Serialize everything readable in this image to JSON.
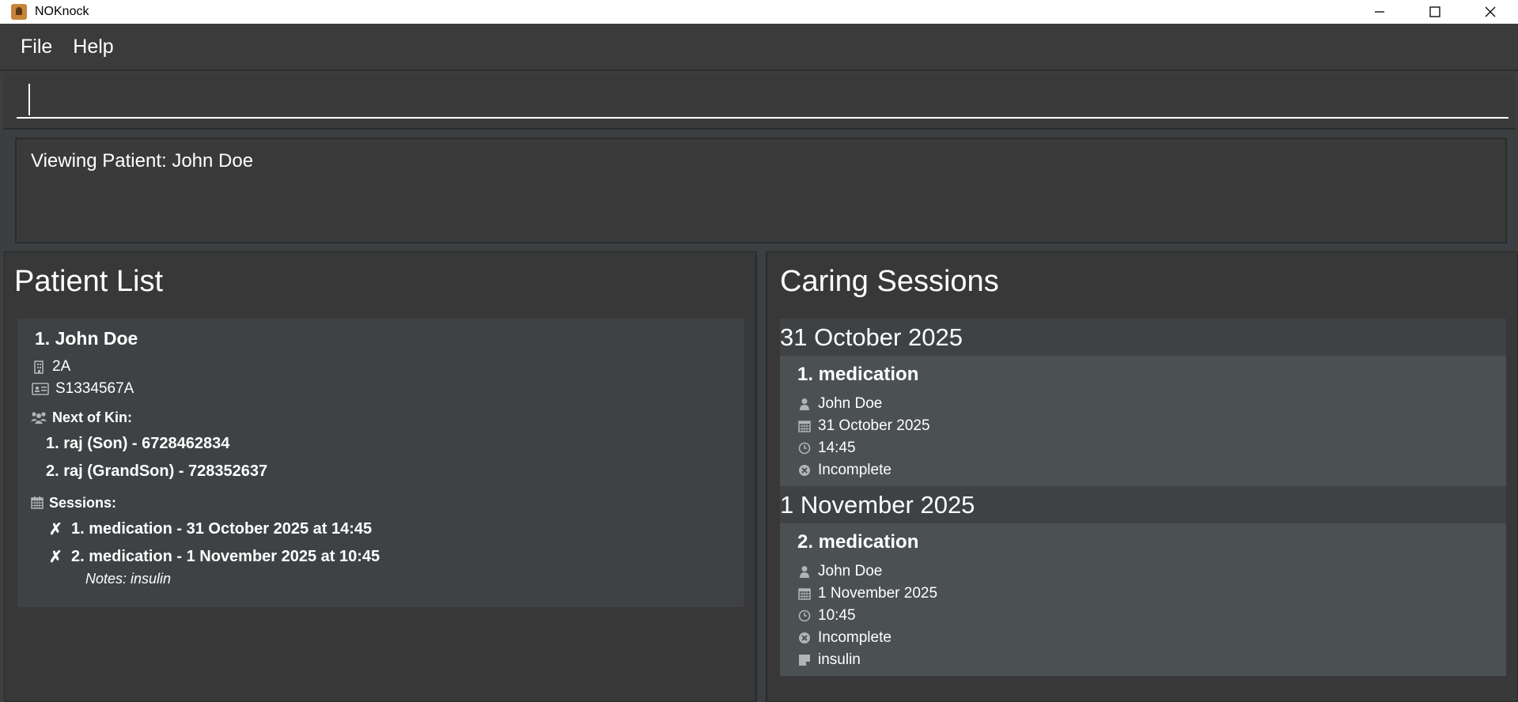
{
  "window": {
    "title": "NOKnock",
    "minimize_label": "—",
    "maximize_label": "☐",
    "close_label": "✕"
  },
  "menu": {
    "file_label": "File",
    "help_label": "Help"
  },
  "command_box": {
    "value": ""
  },
  "result_display": {
    "text": "Viewing Patient: John Doe"
  },
  "patient_list": {
    "title": "Patient List",
    "patients": [
      {
        "name": "1. John Doe",
        "ward": "2A",
        "ic": "S1334567A",
        "nok_label": "Next of Kin:",
        "next_of_kin": [
          "1. raj (Son) - 6728462834",
          "2. raj (GrandSon) - 728352637"
        ],
        "sessions_label": "Sessions:",
        "sessions": [
          {
            "status_icon": "✗",
            "text": "1. medication - 31 October 2025 at 14:45"
          },
          {
            "status_icon": "✗",
            "text": "2. medication - 1 November 2025 at 10:45",
            "notes": "Notes: insulin"
          }
        ]
      }
    ]
  },
  "caring_sessions": {
    "title": "Caring Sessions",
    "groups": [
      {
        "date_header": "31 October 2025",
        "session": {
          "title": "1. medication",
          "patient": "John Doe",
          "date": "31 October 2025",
          "time": "14:45",
          "status": "Incomplete"
        }
      },
      {
        "date_header": "1 November 2025",
        "session": {
          "title": "2. medication",
          "patient": "John Doe",
          "date": "1 November 2025",
          "time": "10:45",
          "status": "Incomplete",
          "note": "insulin"
        }
      }
    ]
  },
  "colors": {
    "background": "#3c3f41",
    "card": "#3f4244",
    "session_card": "#4b5052",
    "text": "#ffffff",
    "icon": "#b0b4b6"
  },
  "icons": [
    "building-icon",
    "id-card-icon",
    "family-icon",
    "calendar-icon",
    "person-icon",
    "clock-icon",
    "x-circle-icon",
    "note-icon"
  ]
}
